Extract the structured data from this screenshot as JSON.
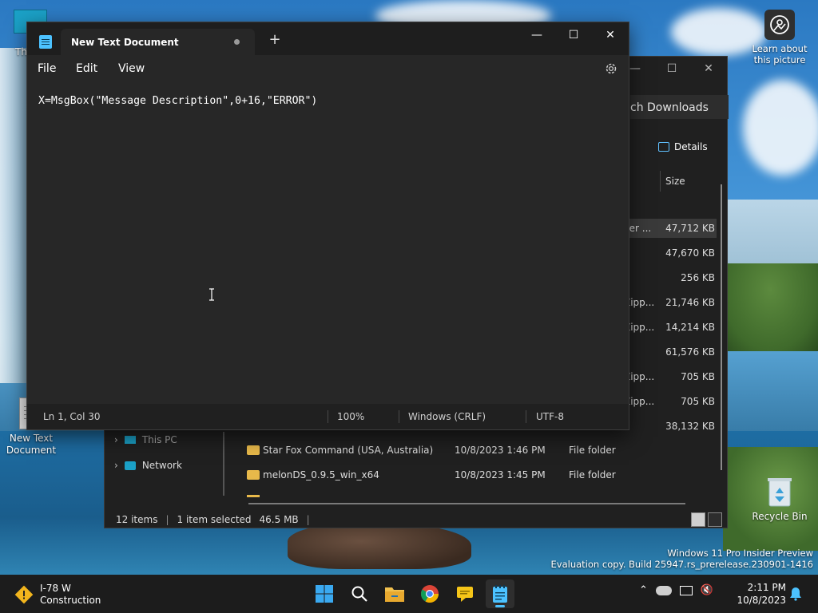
{
  "desktop": {
    "top_icon_label": "Th",
    "learn_about": "Learn about this picture",
    "new_text_document": "New Text Document",
    "recycle_bin": "Recycle Bin",
    "watermark": {
      "line1": "Windows 11 Pro Insider Preview",
      "line2": "Evaluation copy. Build 25947.rs_prerelease.230901-1416"
    }
  },
  "explorer": {
    "search_text": "ch Downloads",
    "details_label": "Details",
    "size_header": "Size",
    "rows": [
      {
        "name": "ller ...",
        "size": "47,712 KB"
      },
      {
        "name": "",
        "size": "47,670 KB"
      },
      {
        "name": "",
        "size": "256 KB"
      },
      {
        "name": "Zipp...",
        "size": "21,746 KB"
      },
      {
        "name": "Zipp...",
        "size": "14,214 KB"
      },
      {
        "name": "",
        "size": "61,576 KB"
      },
      {
        "name": "Zipp...",
        "size": "705 KB"
      },
      {
        "name": "Zipp...",
        "size": "705 KB"
      },
      {
        "name": "",
        "size": "38,132 KB"
      }
    ],
    "nav": [
      {
        "label": "This PC"
      },
      {
        "label": "Network"
      }
    ],
    "files": [
      {
        "name": "Star Fox Command (USA, Australia)",
        "date": "10/8/2023 1:46 PM",
        "type": "File folder"
      },
      {
        "name": "melonDS_0.9.5_win_x64",
        "date": "10/8/2023 1:45 PM",
        "type": "File folder"
      }
    ],
    "status": {
      "items": "12 items",
      "selected": "1 item selected",
      "size": "46.5 MB"
    }
  },
  "notepad": {
    "tab_title": "New Text Document",
    "menu": {
      "file": "File",
      "edit": "Edit",
      "view": "View"
    },
    "content": "X=MsgBox(\"Message Description\",0+16,\"ERROR\")",
    "status": {
      "position": "Ln 1, Col 30",
      "zoom": "100%",
      "line_ending": "Windows (CRLF)",
      "encoding": "UTF-8"
    }
  },
  "taskbar": {
    "weather_title": "I-78 W",
    "weather_sub": "Construction",
    "time": "2:11 PM",
    "date": "10/8/2023"
  }
}
